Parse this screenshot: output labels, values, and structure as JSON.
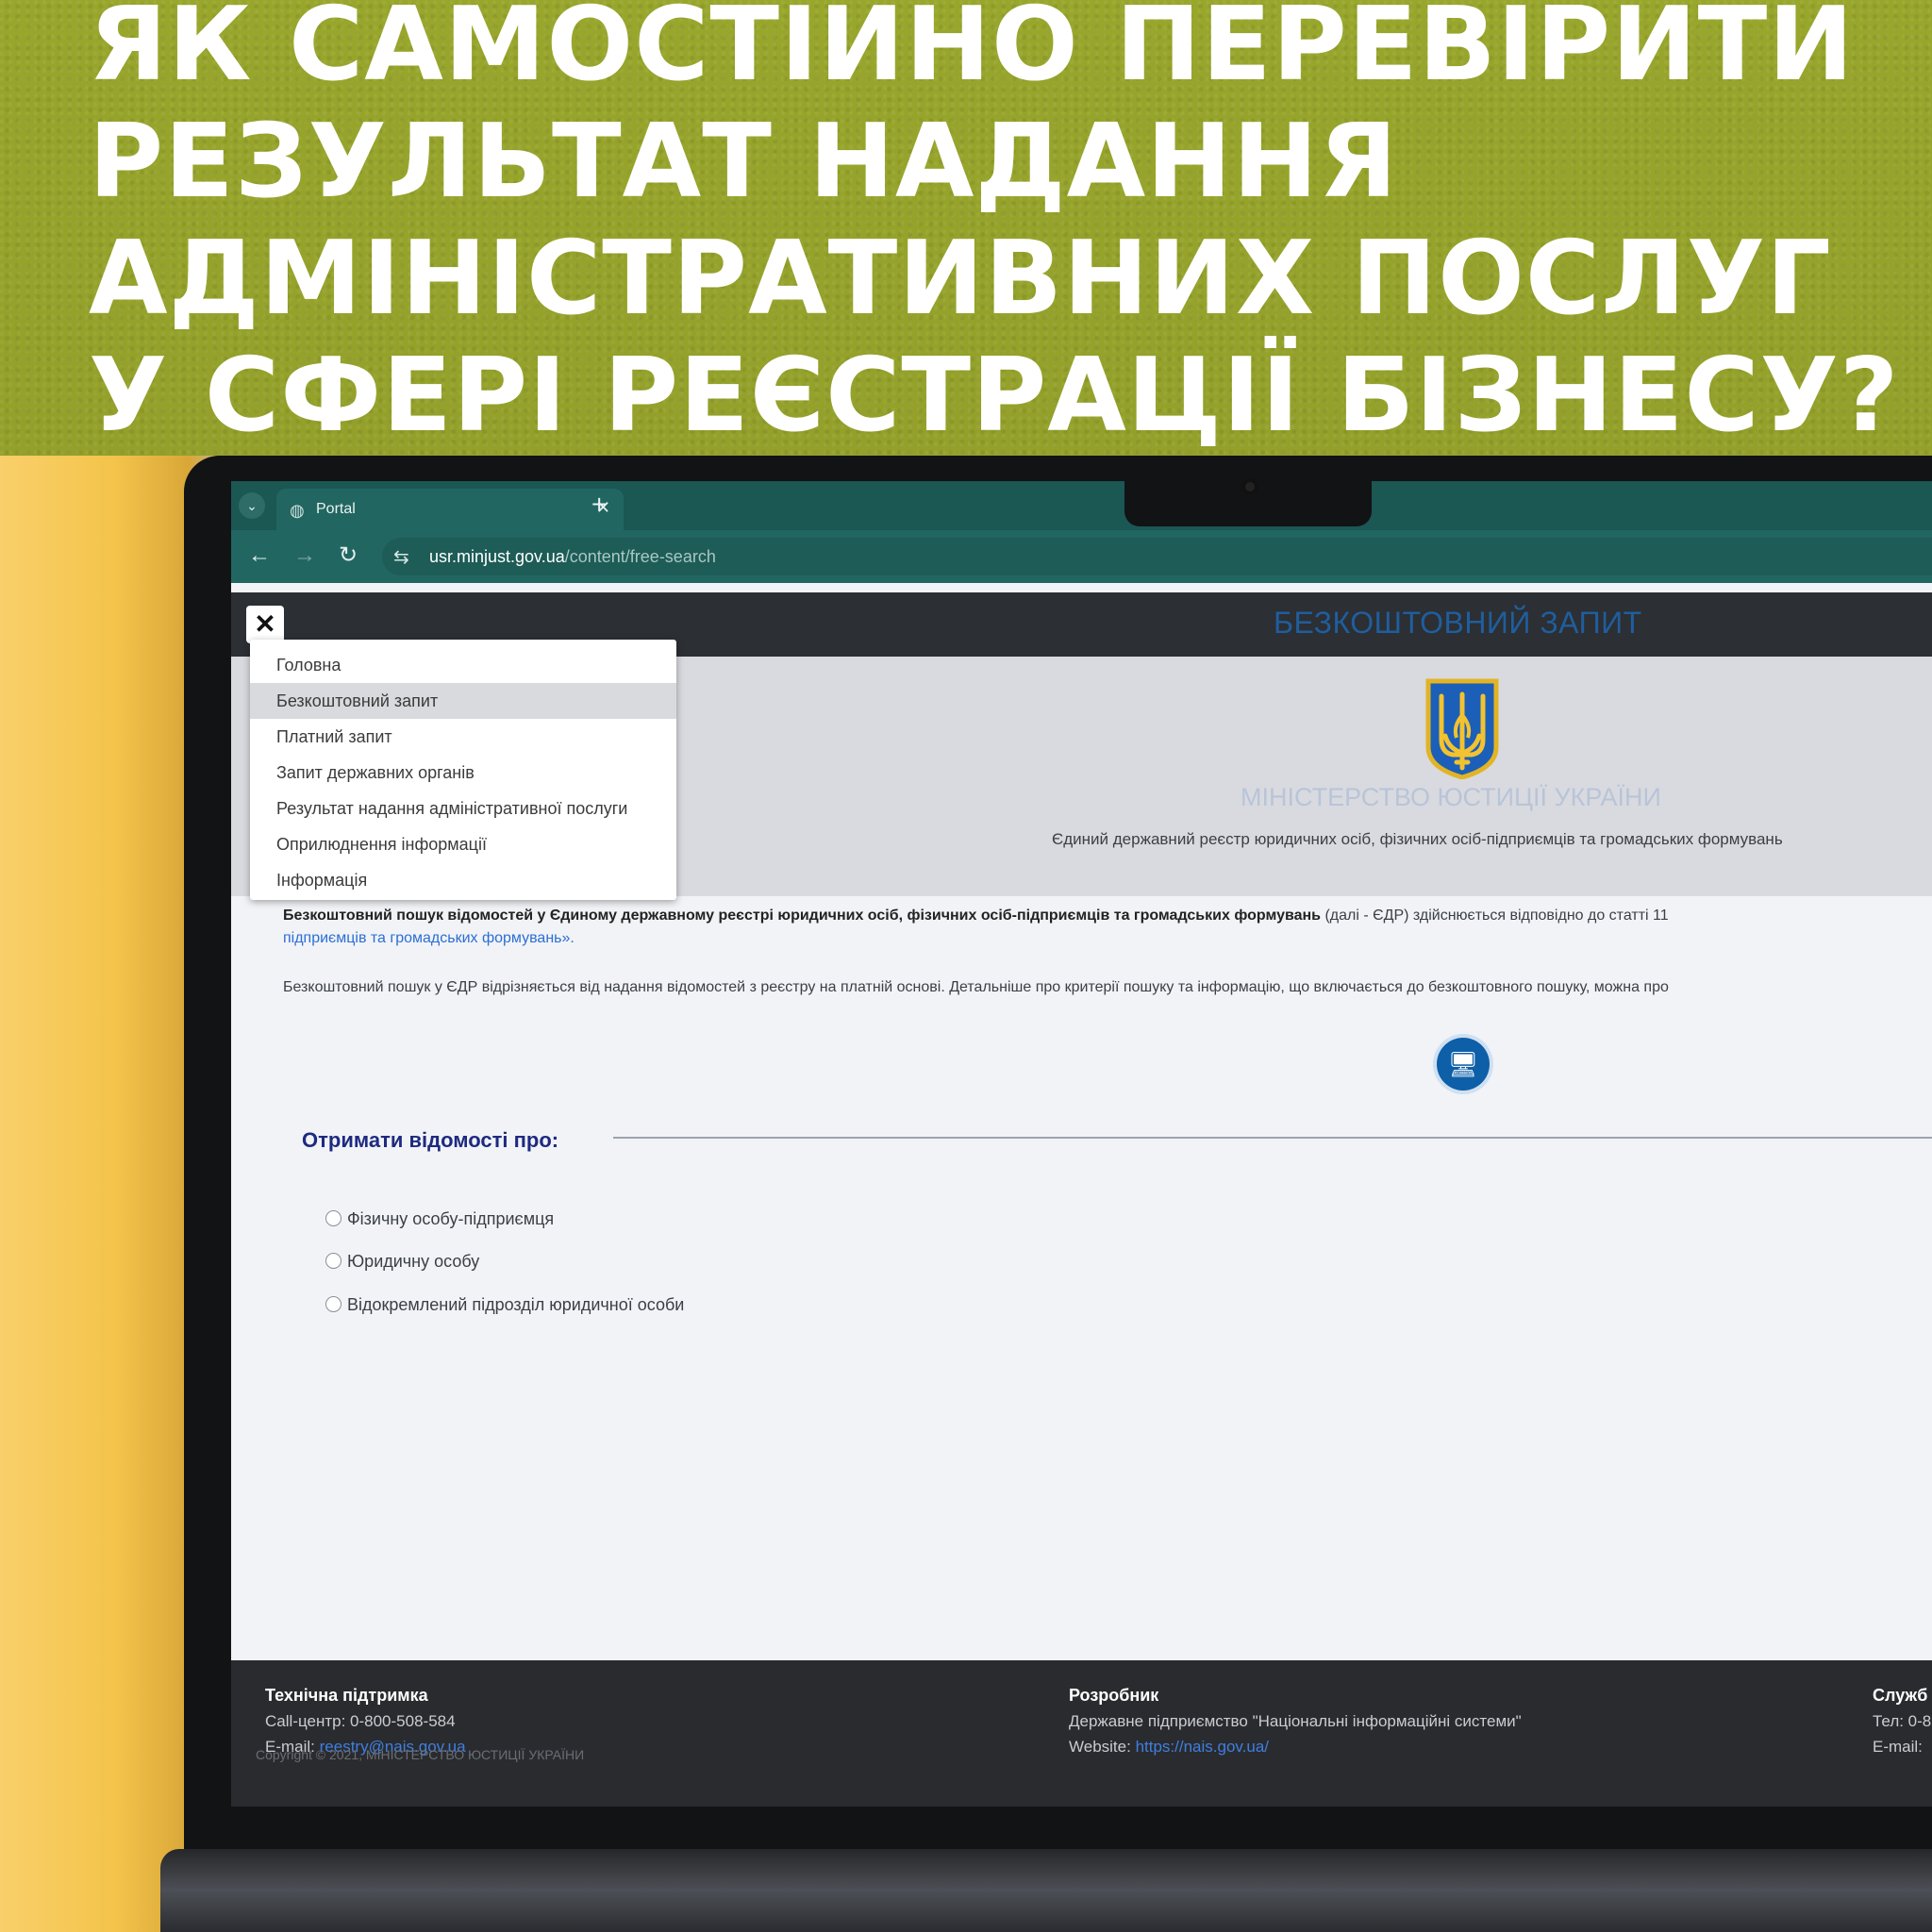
{
  "headline": {
    "lines": [
      "ЯК САМОСТІЙНО ПЕРЕВІРИТИ",
      "РЕЗУЛЬТАТ НАДАННЯ",
      "АДМІНІСТРАТИВНИХ ПОСЛУГ",
      "У СФЕРІ РЕЄСТРАЦІЇ БІЗНЕСУ?"
    ]
  },
  "browser": {
    "tab_title": "Portal",
    "url_domain": "usr.minjust.gov.ua",
    "url_path": "/content/free-search"
  },
  "site": {
    "title": "БЕЗКОШТОВНИЙ ЗАПИТ",
    "ministry": "МІНІСТЕРСТВО ЮСТИЦІЇ УКРАЇНИ",
    "registry_name": "Єдиний державний реєстр юридичних осіб, фізичних осіб-підприємців та громадських формувань"
  },
  "menu": {
    "items": [
      "Головна",
      "Безкоштовний запит",
      "Платний запит",
      "Запит державних органів",
      "Результат надання адміністративної послуги",
      "Оприлюднення інформації",
      "Інформація"
    ]
  },
  "content": {
    "intro_bold": "Безкоштовний пошук відомостей у Єдиному державному реєстрі юридичних осіб, фізичних осіб-підприємців та громадських формувань",
    "intro_rest": "(далі - ЄДР) здійснюється відповідно до статті 11",
    "intro_link": "підприємців та громадських формувань».",
    "intro2": "Безкоштовний пошук у ЄДР відрізняється від надання відомостей з реєстру на платній основі. Детальніше про критерії пошуку та інформацію, що включається до безкоштовного пошуку, можна про",
    "get_info_label": "Отримати відомості про:",
    "options": [
      "Фізичну особу-підприємця",
      "Юридичну особу",
      "Відокремлений підрозділ юридичної особи"
    ]
  },
  "footer": {
    "support_title": "Технічна підтримка",
    "support_phone": "Call-центр: 0-800-508-584",
    "support_email_label": "E-mail:",
    "support_email": "reestry@nais.gov.ua",
    "dev_title": "Розробник",
    "dev_name": "Державне підприємство \"Національні інформаційні системи\"",
    "dev_site_label": "Website:",
    "dev_site": "https://nais.gov.ua/",
    "service_title": "Служб",
    "service_phone": "Тел: 0-8",
    "service_email": "E-mail:",
    "copyright": "Copyright © 2021, МІНІСТЕРСТВО ЮСТИЦІЇ УКРАЇНИ"
  },
  "colors": {
    "banner": "#98a62c",
    "browser_chrome": "#226661",
    "site_title": "#1f5e9e",
    "link": "#2c6ed5"
  },
  "icons": [
    "chevron-down-icon",
    "globe-icon",
    "close-icon",
    "plus-icon",
    "back-icon",
    "forward-icon",
    "reload-icon",
    "site-settings-icon",
    "trident-emblem",
    "monitor-icon"
  ]
}
